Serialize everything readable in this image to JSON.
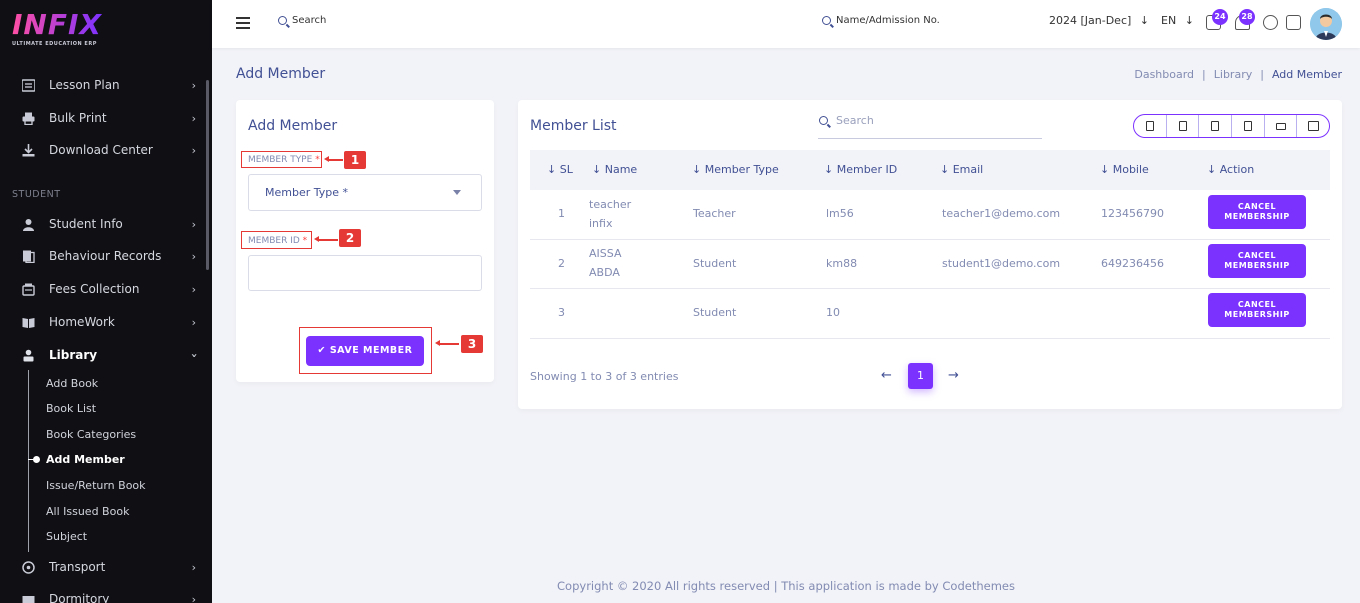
{
  "app": {
    "logo_text": "INFIX",
    "logo_tagline": "ULTIMATE EDUCATION ERP"
  },
  "sidebar": {
    "items_top": [
      {
        "label": "Lesson Plan",
        "icon": "list-icon"
      },
      {
        "label": "Bulk Print",
        "icon": "printer-icon"
      },
      {
        "label": "Download Center",
        "icon": "download-icon"
      }
    ],
    "section_label": "STUDENT",
    "items_student": [
      {
        "label": "Student Info",
        "icon": "user-icon"
      },
      {
        "label": "Behaviour Records",
        "icon": "records-icon"
      },
      {
        "label": "Fees Collection",
        "icon": "fees-icon"
      },
      {
        "label": "HomeWork",
        "icon": "book-open-icon"
      },
      {
        "label": "Library",
        "icon": "library-icon"
      }
    ],
    "library_sub": [
      "Add Book",
      "Book List",
      "Book Categories",
      "Add Member",
      "Issue/Return Book",
      "All Issued Book",
      "Subject"
    ],
    "items_bottom": [
      {
        "label": "Transport",
        "icon": "transport-icon"
      },
      {
        "label": "Dormitory",
        "icon": "dormitory-icon"
      }
    ]
  },
  "topbar": {
    "search_label": "Search",
    "search2_label": "Name/Admission No.",
    "session": "2024 [Jan-Dec]",
    "language": "EN",
    "messages_count": "24",
    "notifications_count": "28"
  },
  "page": {
    "title": "Add Member",
    "breadcrumb": [
      "Dashboard",
      "Library",
      "Add Member"
    ]
  },
  "form": {
    "title": "Add Member",
    "member_type_label": "MEMBER TYPE",
    "member_type_placeholder": "Member Type *",
    "member_id_label": "MEMBER ID",
    "required_mark": "*",
    "save_label": "SAVE MEMBER",
    "annotations": [
      "1",
      "2",
      "3"
    ]
  },
  "list": {
    "title": "Member List",
    "search_placeholder": "Search",
    "columns": [
      "SL",
      "Name",
      "Member Type",
      "Member ID",
      "Email",
      "Mobile",
      "Action"
    ],
    "rows": [
      {
        "sl": "1",
        "name_1": "teacher",
        "name_2": "infix",
        "type": "Teacher",
        "member_id": "lm56",
        "email": "teacher1@demo.com",
        "mobile": "123456790",
        "action": "CANCEL MEMBERSHIP"
      },
      {
        "sl": "2",
        "name_1": "AISSA",
        "name_2": "ABDA",
        "type": "Student",
        "member_id": "km88",
        "email": "student1@demo.com",
        "mobile": "649236456",
        "action": "CANCEL MEMBERSHIP"
      },
      {
        "sl": "3",
        "name_1": "",
        "name_2": "",
        "type": "Student",
        "member_id": "10",
        "email": "",
        "mobile": "",
        "action": "CANCEL MEMBERSHIP"
      }
    ],
    "showing": "Showing 1 to 3 of 3 entries",
    "current_page": "1",
    "prev": "←",
    "next": "→"
  },
  "footer": {
    "text": "Copyright © 2020 All rights reserved | This application is made by Codethemes"
  },
  "colors": {
    "accent": "#7c32ff",
    "sidebar_bg": "#0f0f14",
    "annotation": "#e53935",
    "text": "#415094"
  }
}
